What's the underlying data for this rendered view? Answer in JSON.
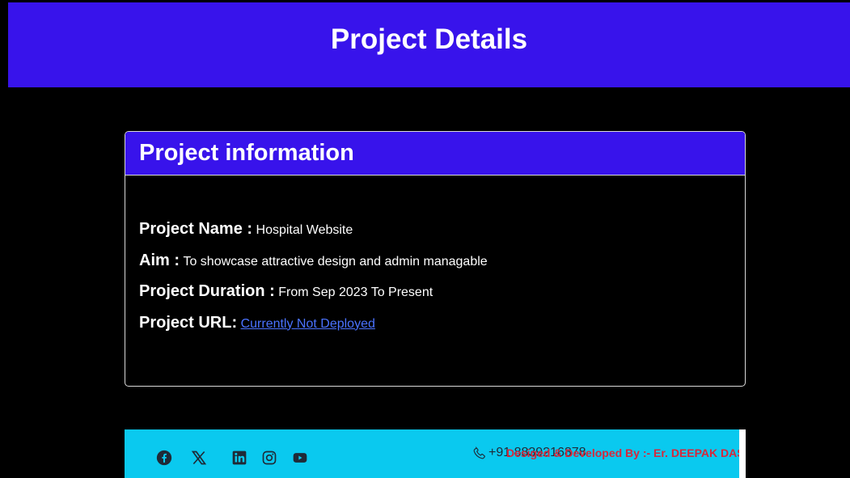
{
  "header": {
    "title": "Project Details"
  },
  "card": {
    "title": "Project information",
    "rows": [
      {
        "label": "Project Name :",
        "value": "Hospital Website"
      },
      {
        "label": "Aim :",
        "value": "To showcase attractive design and admin managable"
      },
      {
        "label": "Project Duration :",
        "value": "From Sep 2023 To Present"
      },
      {
        "label": "Project URL:",
        "link": "Currently Not Deployed"
      }
    ]
  },
  "footer": {
    "social_icons": [
      "facebook-icon",
      "x-twitter-icon",
      "linkedin-icon",
      "instagram-icon",
      "youtube-icon"
    ],
    "phone": "+91 8839216878",
    "credit": "Desiged & Developed By :- Er. DEEPAK DAS"
  },
  "colors": {
    "header_bg": "#3813eb",
    "page_bg": "#000000",
    "footer_bg": "#0ac9ef",
    "link": "#4a72ff",
    "credit": "#d6283b"
  }
}
